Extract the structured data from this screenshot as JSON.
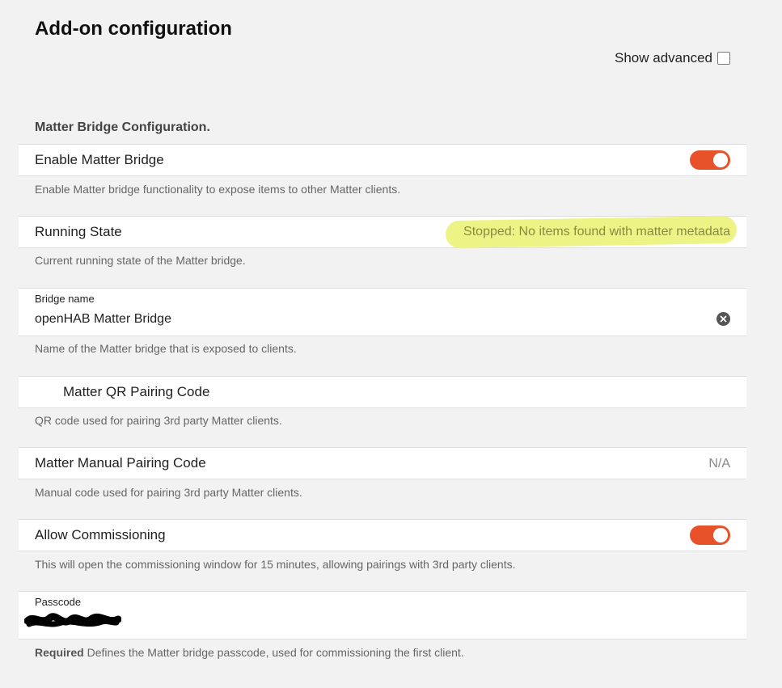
{
  "page": {
    "title": "Add-on configuration",
    "show_advanced_label": "Show advanced"
  },
  "section": {
    "title": "Matter Bridge Configuration."
  },
  "fields": {
    "enable_bridge": {
      "label": "Enable Matter Bridge",
      "description": "Enable Matter bridge functionality to expose items to other Matter clients.",
      "enabled": true
    },
    "running_state": {
      "label": "Running State",
      "value": "Stopped: No items found with matter metadata",
      "description": "Current running state of the Matter bridge."
    },
    "bridge_name": {
      "label": "Bridge name",
      "value": "openHAB Matter Bridge",
      "description": "Name of the Matter bridge that is exposed to clients."
    },
    "qr_code": {
      "label": "Matter QR Pairing Code",
      "description": "QR code used for pairing 3rd party Matter clients."
    },
    "manual_code": {
      "label": "Matter Manual Pairing Code",
      "value": "N/A",
      "description": "Manual code used for pairing 3rd party Matter clients."
    },
    "allow_commissioning": {
      "label": "Allow Commissioning",
      "description": "This will open the commissioning window for 15 minutes, allowing pairings with 3rd party clients.",
      "enabled": true
    },
    "passcode": {
      "label": "Passcode",
      "required_label": "Required",
      "description": " Defines the Matter bridge passcode, used for commissioning the first client."
    }
  },
  "colors": {
    "accent": "#e8522a",
    "highlight": "#eef386",
    "background": "#f2f2f2"
  }
}
